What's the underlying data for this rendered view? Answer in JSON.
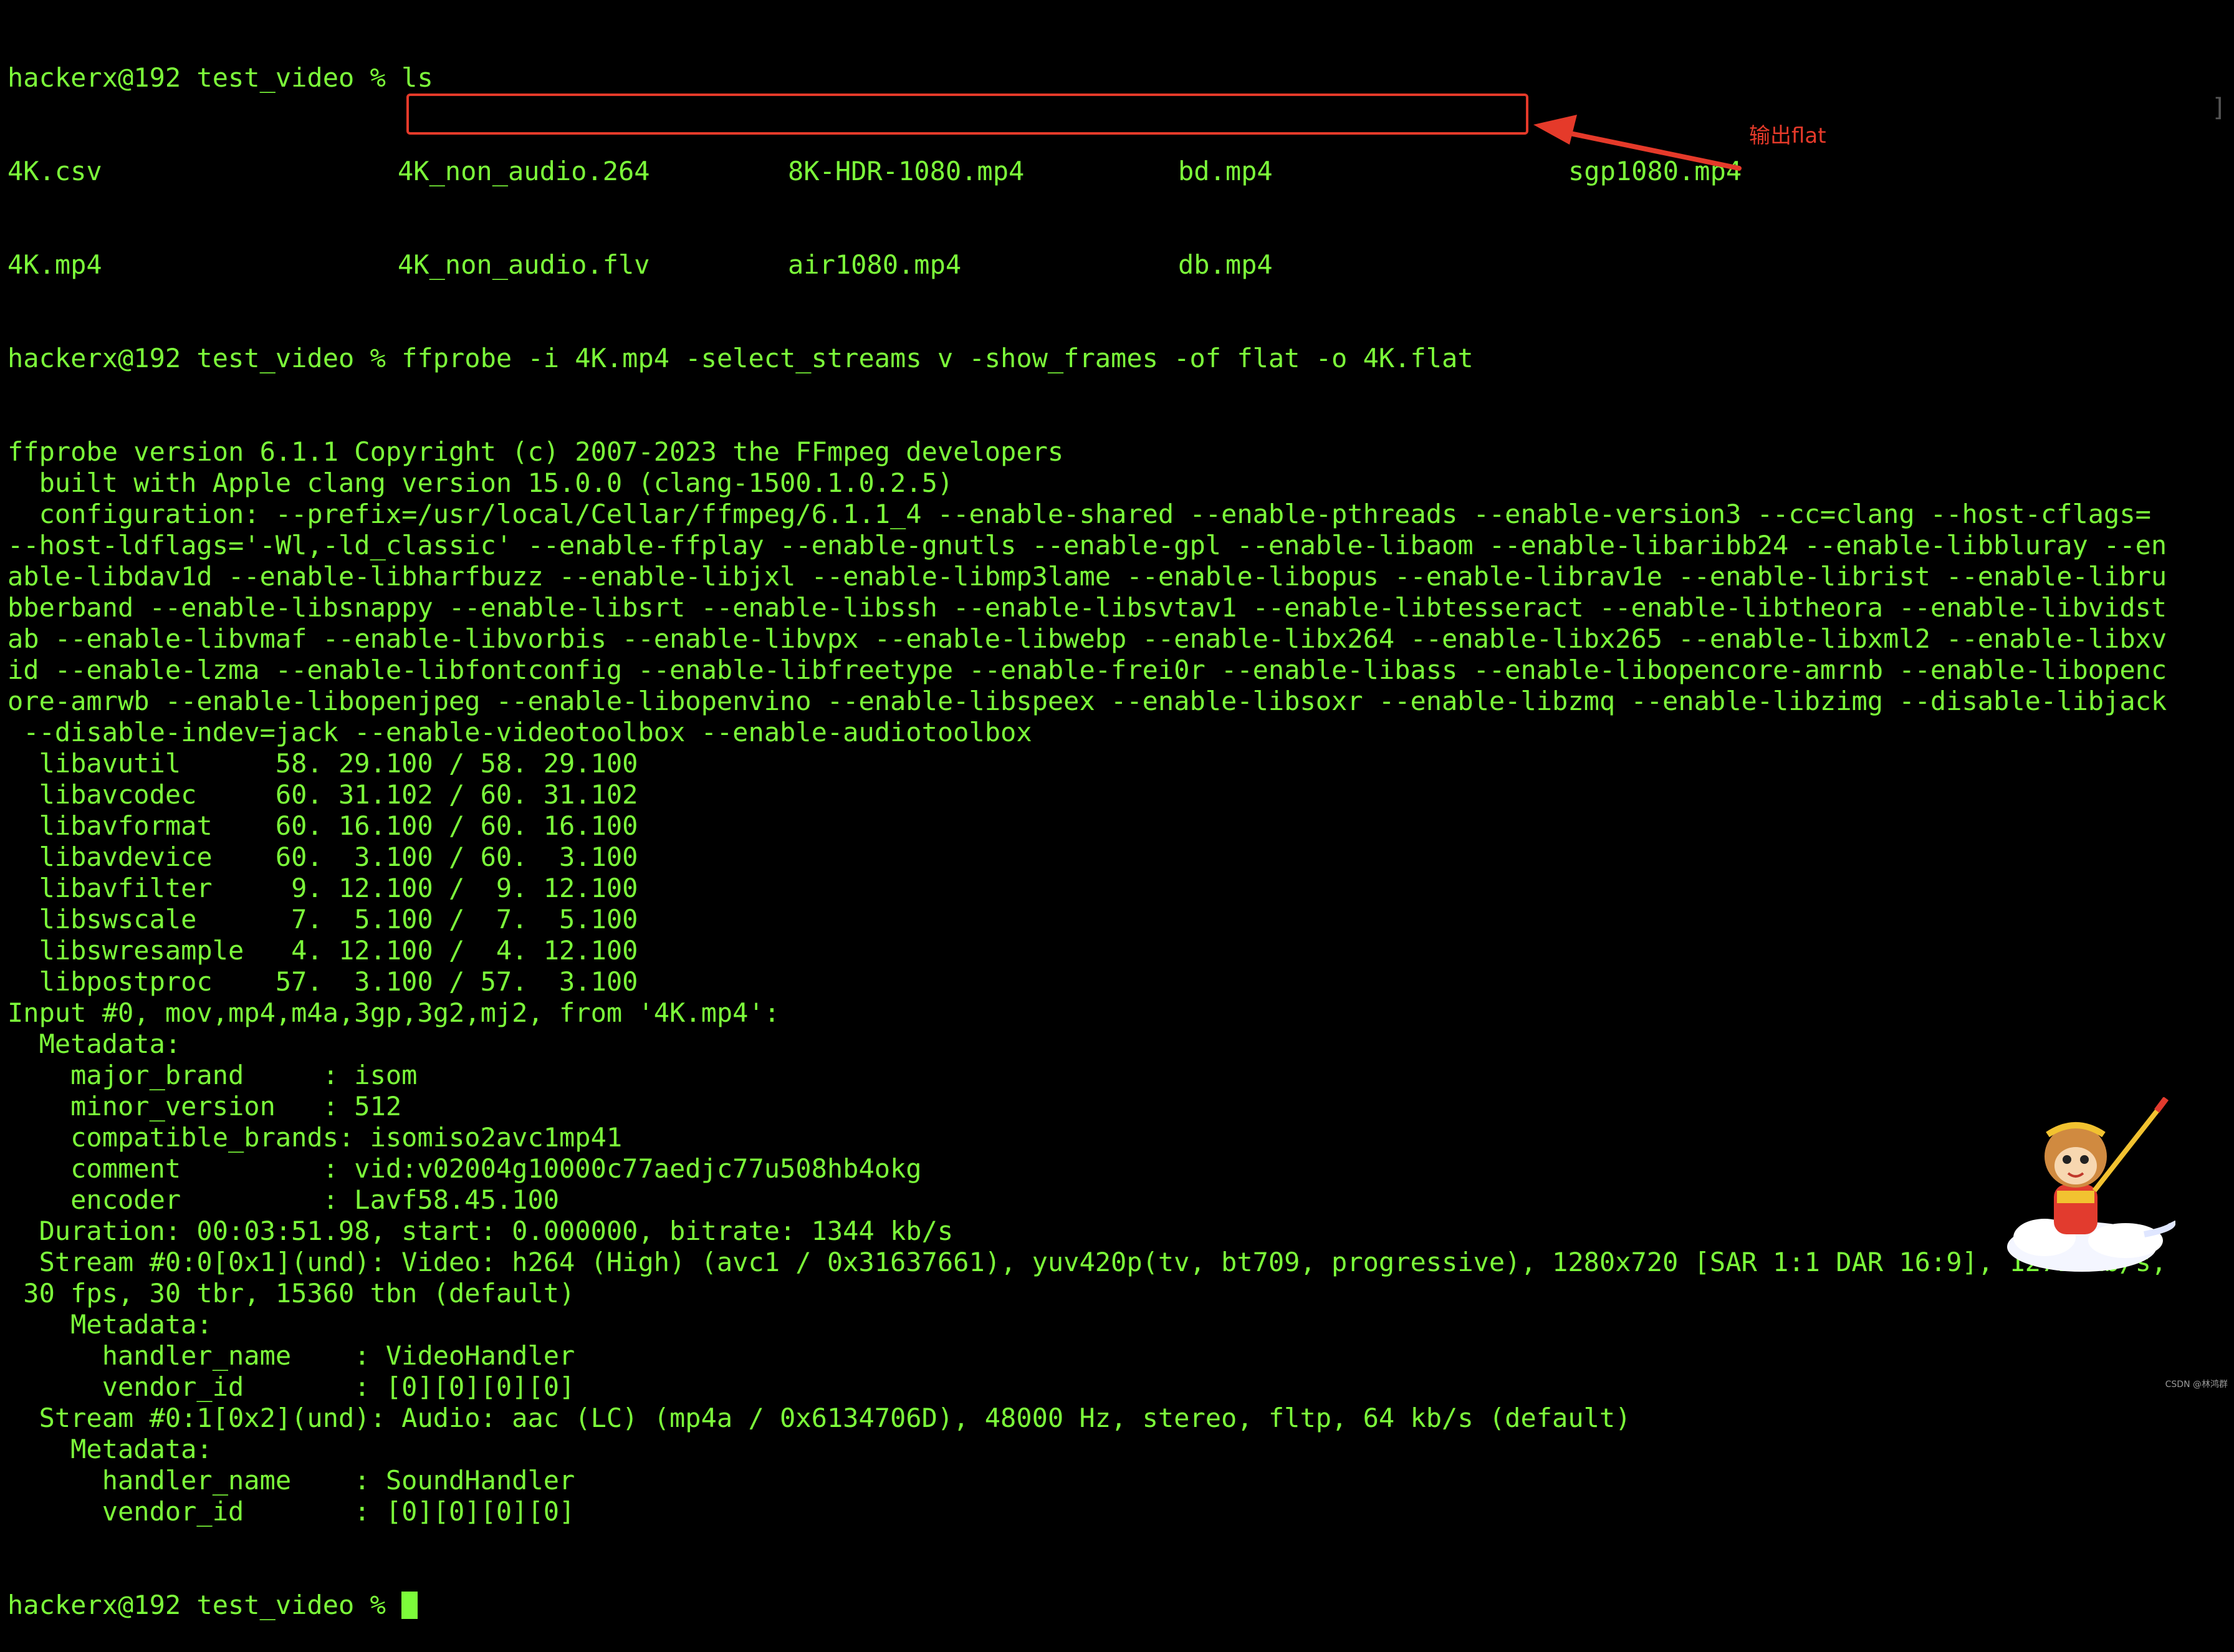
{
  "terminal": {
    "prompt": "hackerx@192 test_video % ",
    "command_ls": "ls",
    "ls_row1": [
      "4K.csv",
      "4K_non_audio.264",
      "8K-HDR-1080.mp4",
      "bd.mp4",
      "sgp1080.mp4"
    ],
    "ls_row2": [
      "4K.mp4",
      "4K_non_audio.flv",
      "air1080.mp4",
      "db.mp4"
    ],
    "command_ffprobe": "ffprobe -i 4K.mp4 -select_streams v -show_frames -of flat -o 4K.flat",
    "output": [
      "ffprobe version 6.1.1 Copyright (c) 2007-2023 the FFmpeg developers",
      "  built with Apple clang version 15.0.0 (clang-1500.1.0.2.5)",
      "  configuration: --prefix=/usr/local/Cellar/ffmpeg/6.1.1_4 --enable-shared --enable-pthreads --enable-version3 --cc=clang --host-cflags=",
      "--host-ldflags='-Wl,-ld_classic' --enable-ffplay --enable-gnutls --enable-gpl --enable-libaom --enable-libaribb24 --enable-libbluray --en",
      "able-libdav1d --enable-libharfbuzz --enable-libjxl --enable-libmp3lame --enable-libopus --enable-librav1e --enable-librist --enable-libru",
      "bberband --enable-libsnappy --enable-libsrt --enable-libssh --enable-libsvtav1 --enable-libtesseract --enable-libtheora --enable-libvidst",
      "ab --enable-libvmaf --enable-libvorbis --enable-libvpx --enable-libwebp --enable-libx264 --enable-libx265 --enable-libxml2 --enable-libxv",
      "id --enable-lzma --enable-libfontconfig --enable-libfreetype --enable-frei0r --enable-libass --enable-libopencore-amrnb --enable-libopenc",
      "ore-amrwb --enable-libopenjpeg --enable-libopenvino --enable-libspeex --enable-libsoxr --enable-libzmq --enable-libzimg --disable-libjack",
      " --disable-indev=jack --enable-videotoolbox --enable-audiotoolbox",
      "  libavutil      58. 29.100 / 58. 29.100",
      "  libavcodec     60. 31.102 / 60. 31.102",
      "  libavformat    60. 16.100 / 60. 16.100",
      "  libavdevice    60.  3.100 / 60.  3.100",
      "  libavfilter     9. 12.100 /  9. 12.100",
      "  libswscale      7.  5.100 /  7.  5.100",
      "  libswresample   4. 12.100 /  4. 12.100",
      "  libpostproc    57.  3.100 / 57.  3.100",
      "Input #0, mov,mp4,m4a,3gp,3g2,mj2, from '4K.mp4':",
      "  Metadata:",
      "    major_brand     : isom",
      "    minor_version   : 512",
      "    compatible_brands: isomiso2avc1mp41",
      "    comment         : vid:v02004g10000c77aedjc77u508hb4okg",
      "    encoder         : Lavf58.45.100",
      "  Duration: 00:03:51.98, start: 0.000000, bitrate: 1344 kb/s",
      "  Stream #0:0[0x1](und): Video: h264 (High) (avc1 / 0x31637661), yuv420p(tv, bt709, progressive), 1280x720 [SAR 1:1 DAR 16:9], 1271 kb/s,",
      " 30 fps, 30 tbr, 15360 tbn (default)",
      "    Metadata:",
      "      handler_name    : VideoHandler",
      "      vendor_id       : [0][0][0][0]",
      "  Stream #0:1[0x2](und): Audio: aac (LC) (mp4a / 0x6134706D), 48000 Hz, stereo, fltp, 64 kb/s (default)",
      "    Metadata:",
      "      handler_name    : SoundHandler",
      "      vendor_id       : [0][0][0][0]"
    ]
  },
  "annotation": {
    "label": "输出flat"
  },
  "watermark": "CSDN @林鸿群",
  "colors": {
    "terminal_text": "#7CFC3A",
    "highlight": "#e53a2a",
    "background": "#000000"
  }
}
